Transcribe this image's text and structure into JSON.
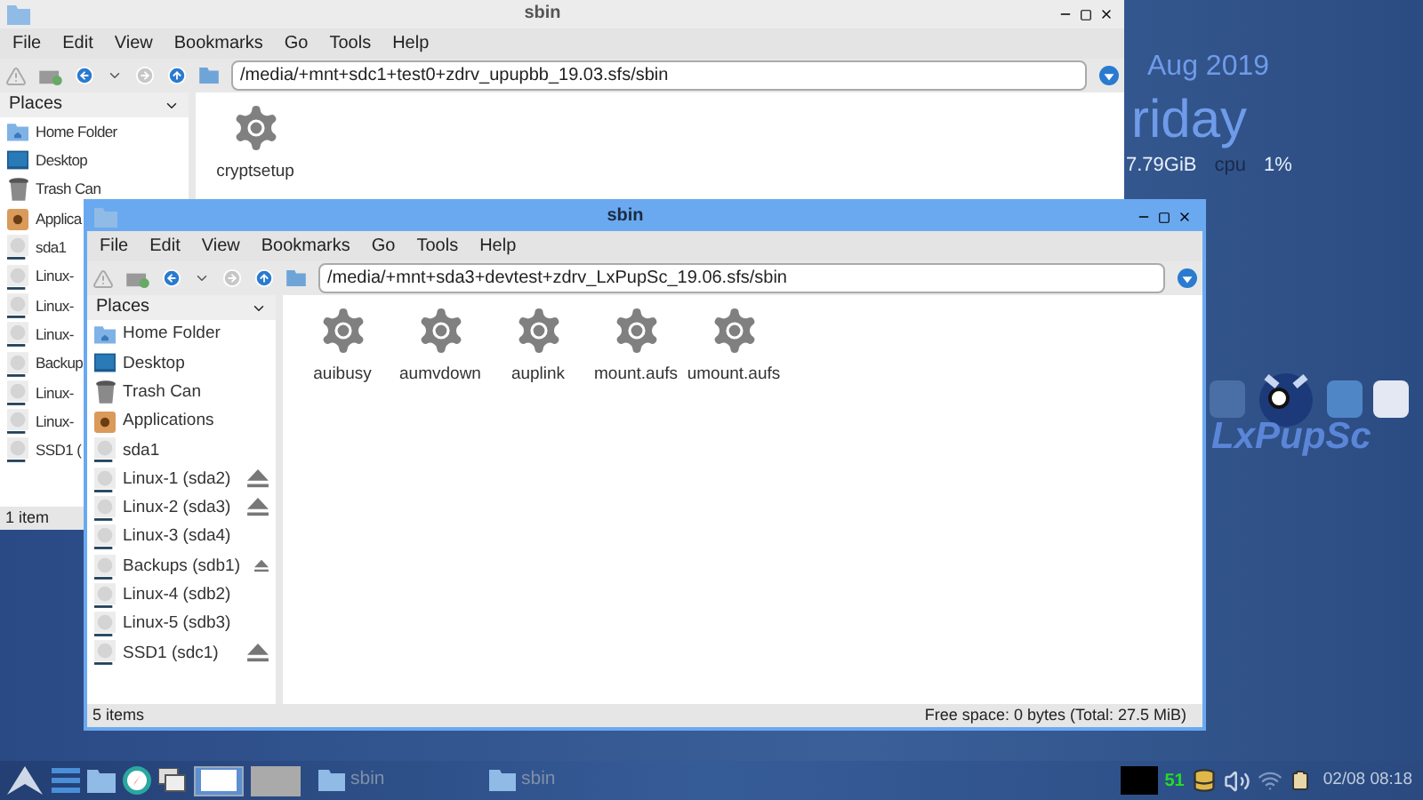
{
  "desktop": {
    "date": "Aug 2019",
    "day": "riday",
    "memory": "7.79GiB",
    "cpu_label": "cpu",
    "cpu_value": "1%",
    "logo_text": "LxPupSc"
  },
  "windows": [
    {
      "title": "sbin",
      "focused": false,
      "menu": [
        "File",
        "Edit",
        "View",
        "Bookmarks",
        "Go",
        "Tools",
        "Help"
      ],
      "path": "/media/+mnt+sdc1+test0+zdrv_upupbb_19.03.sfs/sbin",
      "places_header": "Places",
      "places": [
        {
          "label": "Home Folder",
          "kind": "home",
          "eject": false
        },
        {
          "label": "Desktop",
          "kind": "desktop",
          "eject": false
        },
        {
          "label": "Trash Can",
          "kind": "trash",
          "eject": false
        },
        {
          "label": "Applica",
          "kind": "apps",
          "eject": false
        },
        {
          "label": "sda1",
          "kind": "drive",
          "eject": false
        },
        {
          "label": "Linux-",
          "kind": "drive",
          "eject": false
        },
        {
          "label": "Linux-",
          "kind": "drive",
          "eject": false
        },
        {
          "label": "Linux-",
          "kind": "drive",
          "eject": false
        },
        {
          "label": "Backup",
          "kind": "drive",
          "eject": false
        },
        {
          "label": "Linux-",
          "kind": "drive",
          "eject": false
        },
        {
          "label": "Linux-",
          "kind": "drive",
          "eject": false
        },
        {
          "label": "SSD1 (",
          "kind": "drive",
          "eject": false
        }
      ],
      "files": [
        "cryptsetup"
      ],
      "status": "1 item"
    },
    {
      "title": "sbin",
      "focused": true,
      "menu": [
        "File",
        "Edit",
        "View",
        "Bookmarks",
        "Go",
        "Tools",
        "Help"
      ],
      "path": "/media/+mnt+sda3+devtest+zdrv_LxPupSc_19.06.sfs/sbin",
      "places_header": "Places",
      "places": [
        {
          "label": "Home Folder",
          "kind": "home",
          "eject": false
        },
        {
          "label": "Desktop",
          "kind": "desktop",
          "eject": false
        },
        {
          "label": "Trash Can",
          "kind": "trash",
          "eject": false
        },
        {
          "label": "Applications",
          "kind": "apps",
          "eject": false
        },
        {
          "label": "sda1",
          "kind": "drive",
          "eject": false
        },
        {
          "label": "Linux-1 (sda2)",
          "kind": "drive",
          "eject": true
        },
        {
          "label": "Linux-2 (sda3)",
          "kind": "drive",
          "eject": true
        },
        {
          "label": "Linux-3 (sda4)",
          "kind": "drive",
          "eject": false
        },
        {
          "label": "Backups (sdb1)",
          "kind": "drive",
          "eject": true
        },
        {
          "label": "Linux-4 (sdb2)",
          "kind": "drive",
          "eject": false
        },
        {
          "label": "Linux-5 (sdb3)",
          "kind": "drive",
          "eject": false
        },
        {
          "label": "SSD1 (sdc1)",
          "kind": "drive",
          "eject": true
        }
      ],
      "files": [
        "auibusy",
        "aumvdown",
        "auplink",
        "mount.aufs",
        "umount.aufs"
      ],
      "status": "5 items",
      "free_space": "Free space: 0 bytes (Total: 27.5 MiB)"
    }
  ],
  "taskbar": {
    "tasks": [
      {
        "label": "sbin"
      },
      {
        "label": "sbin"
      }
    ],
    "temperature": "51",
    "clock": "02/08 08:18"
  }
}
